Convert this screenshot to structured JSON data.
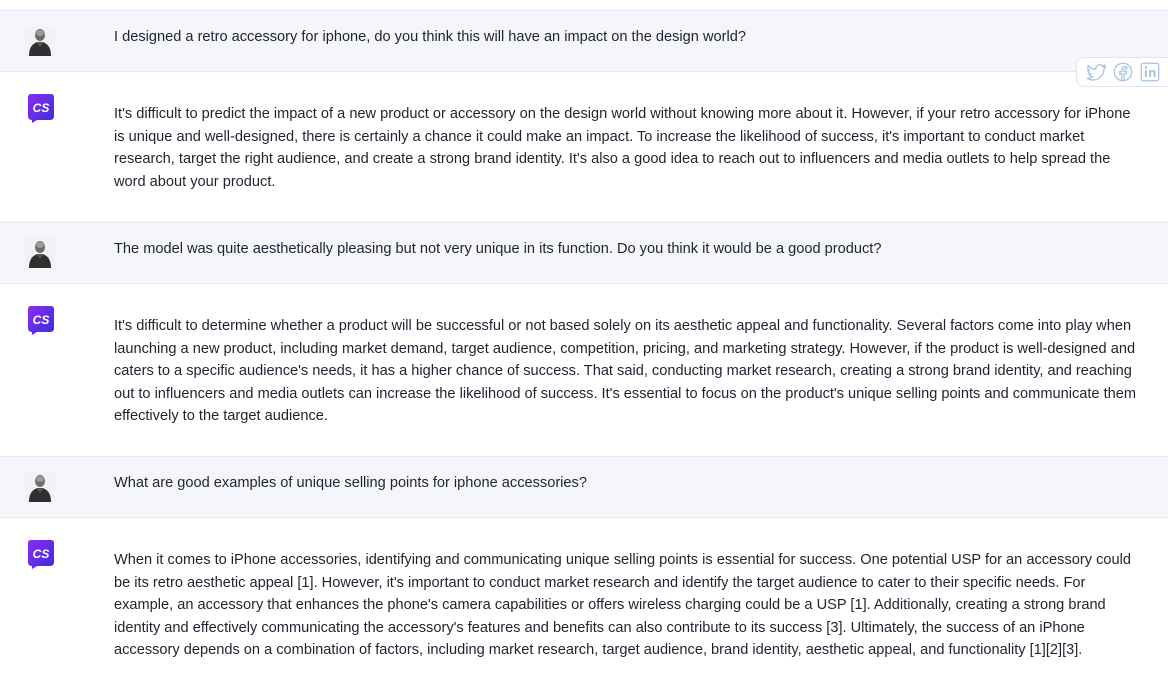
{
  "share": {
    "icons": [
      "twitter-icon",
      "facebook-icon",
      "linkedin-icon"
    ],
    "color": "#a7c3df"
  },
  "avatars": {
    "bot_text": "CS",
    "bot_gradient": [
      "#8d2cf2",
      "#3a2fd8"
    ]
  },
  "messages": [
    {
      "role": "user",
      "text": "I designed a retro accessory for iphone, do you think this will have an impact on the design world?"
    },
    {
      "role": "bot",
      "text": "It's difficult to predict the impact of a new product or accessory on the design world without knowing more about it. However, if your retro accessory for iPhone is unique and well-designed, there is certainly a chance it could make an impact. To increase the likelihood of success, it's important to conduct market research, target the right audience, and create a strong brand identity. It's also a good idea to reach out to influencers and media outlets to help spread the word about your product."
    },
    {
      "role": "user",
      "text": "The model was quite aesthetically pleasing but not very unique in its function. Do you think it would be a good product?"
    },
    {
      "role": "bot",
      "text": "It's difficult to determine whether a product will be successful or not based solely on its aesthetic appeal and functionality. Several factors come into play when launching a new product, including market demand, target audience, competition, pricing, and marketing strategy. However, if the product is well-designed and caters to a specific audience's needs, it has a higher chance of success. That said, conducting market research, creating a strong brand identity, and reaching out to influencers and media outlets can increase the likelihood of success. It's essential to focus on the product's unique selling points and communicate them effectively to the target audience."
    },
    {
      "role": "user",
      "text": "What are good examples of unique selling points for iphone accessories?"
    },
    {
      "role": "bot",
      "text": "When it comes to iPhone accessories, identifying and communicating unique selling points is essential for success. One potential USP for an accessory could be its retro aesthetic appeal [1]. However, it's important to conduct market research and identify the target audience to cater to their specific needs. For example, an accessory that enhances the phone's camera capabilities or offers wireless charging could be a USP [1]. Additionally, creating a strong brand identity and effectively communicating the accessory's features and benefits can also contribute to its success [3]. Ultimately, the success of an iPhone accessory depends on a combination of factors, including market research, target audience, brand identity, aesthetic appeal, and functionality [1][2][3]."
    }
  ]
}
